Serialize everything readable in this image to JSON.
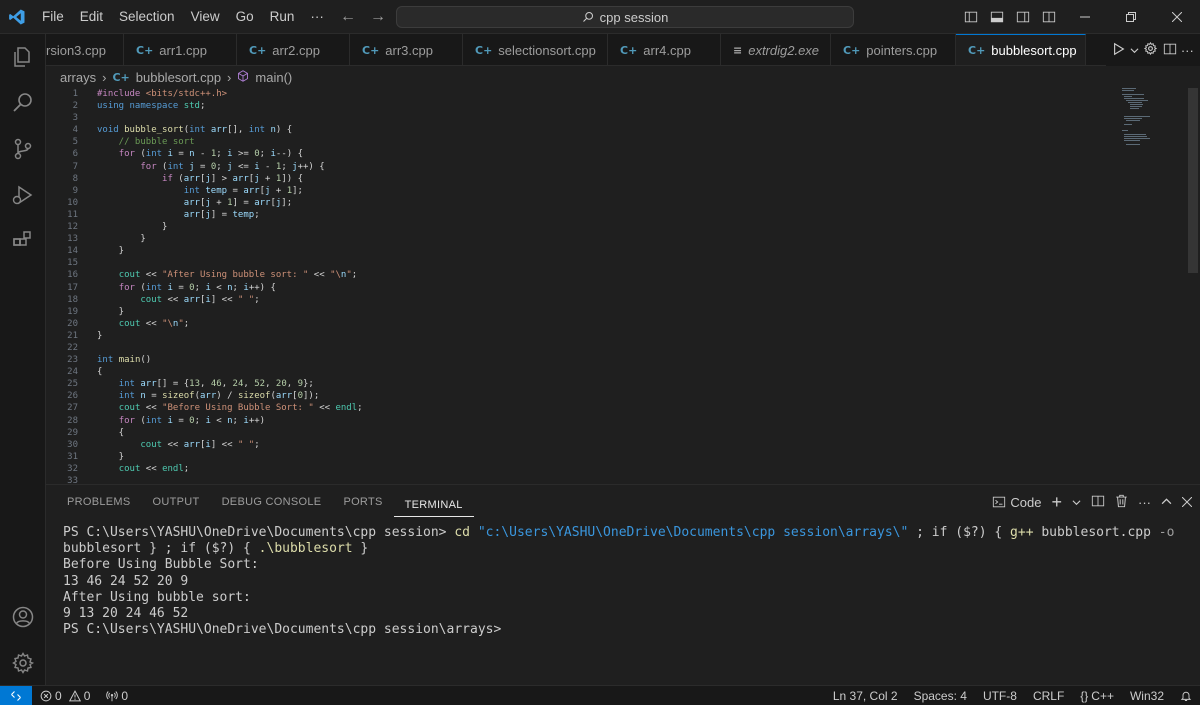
{
  "titlebar": {
    "menu": [
      "File",
      "Edit",
      "Selection",
      "View",
      "Go",
      "Run",
      "···"
    ],
    "search": "cpp session"
  },
  "tabs": [
    {
      "label": "rsion3.cpp",
      "icon": "C+",
      "active": false
    },
    {
      "label": "arr1.cpp",
      "icon": "C+",
      "active": false
    },
    {
      "label": "arr2.cpp",
      "icon": "C+",
      "active": false
    },
    {
      "label": "arr3.cpp",
      "icon": "C+",
      "active": false
    },
    {
      "label": "selectionsort.cpp",
      "icon": "C+",
      "active": false
    },
    {
      "label": "arr4.cpp",
      "icon": "C+",
      "active": false
    },
    {
      "label": "extrdig2.exe",
      "icon": "≡",
      "active": false
    },
    {
      "label": "pointers.cpp",
      "icon": "C+",
      "active": false
    },
    {
      "label": "bubblesort.cpp",
      "icon": "C+",
      "active": true
    }
  ],
  "breadcrumb": {
    "folder": "arrays",
    "file": "bubblesort.cpp",
    "symbol": "main()"
  },
  "editor": {
    "line_numbers": [
      "1",
      "2",
      "3",
      "4",
      "5",
      "6",
      "7",
      "8",
      "9",
      "10",
      "11",
      "12",
      "13",
      "14",
      "15",
      "16",
      "17",
      "18",
      "19",
      "20",
      "21",
      "22",
      "23",
      "24",
      "25",
      "26",
      "27",
      "28",
      "29",
      "30",
      "31",
      "32",
      "33"
    ],
    "lines": [
      "#include <bits/stdc++.h>",
      "using namespace std;",
      "",
      "void bubble_sort(int arr[], int n) {",
      "    // bubble sort",
      "    for (int i = n - 1; i >= 0; i--) {",
      "        for (int j = 0; j <= i - 1; j++) {",
      "            if (arr[j] > arr[j + 1]) {",
      "                int temp = arr[j + 1];",
      "                arr[j + 1] = arr[j];",
      "                arr[j] = temp;",
      "            }",
      "        }",
      "    }",
      "",
      "    cout << \"After Using bubble sort: \" << \"\\n\";",
      "    for (int i = 0; i < n; i++) {",
      "        cout << arr[i] << \" \";",
      "    }",
      "    cout << \"\\n\";",
      "}",
      "",
      "int main()",
      "{",
      "    int arr[] = {13, 46, 24, 52, 20, 9};",
      "    int n = sizeof(arr) / sizeof(arr[0]);",
      "    cout << \"Before Using Bubble Sort: \" << endl;",
      "    for (int i = 0; i < n; i++)",
      "    {",
      "        cout << arr[i] << \" \";",
      "    }",
      "    cout << endl;",
      ""
    ]
  },
  "panel": {
    "tabs": [
      "PROBLEMS",
      "OUTPUT",
      "DEBUG CONSOLE",
      "PORTS",
      "TERMINAL"
    ],
    "active_tab": "TERMINAL",
    "terminal_profile": "Code",
    "terminal": {
      "prompt1": "PS C:\\Users\\YASHU\\OneDrive\\Documents\\cpp session> ",
      "cmd_cd": "cd",
      "cmd_path": "\"c:\\Users\\YASHU\\OneDrive\\Documents\\cpp session\\arrays\\\"",
      "cmd_rest1": " ; if ($?) { ",
      "cmd_gpp": "g++",
      "cmd_rest2": " bubblesort.cpp ",
      "cmd_flag": "-o",
      "cmd_rest3": " bubblesort } ; if ($?) { ",
      "cmd_run": ".\\bubblesort",
      "cmd_end": " }",
      "out1": "Before Using Bubble Sort:",
      "out2": "13 46 24 52 20 9",
      "out3": "After Using bubble sort:",
      "out4": "9 13 20 24 46 52",
      "prompt2": "PS C:\\Users\\YASHU\\OneDrive\\Documents\\cpp session\\arrays>"
    }
  },
  "statusbar": {
    "errors": "0",
    "warnings": "0",
    "ports": "0",
    "position": "Ln 37, Col 2",
    "spaces": "Spaces: 4",
    "encoding": "UTF-8",
    "eol": "CRLF",
    "language": "C++",
    "platform": "Win32"
  },
  "colors": {
    "accent": "#0078d4",
    "background": "#1f1f1f"
  }
}
